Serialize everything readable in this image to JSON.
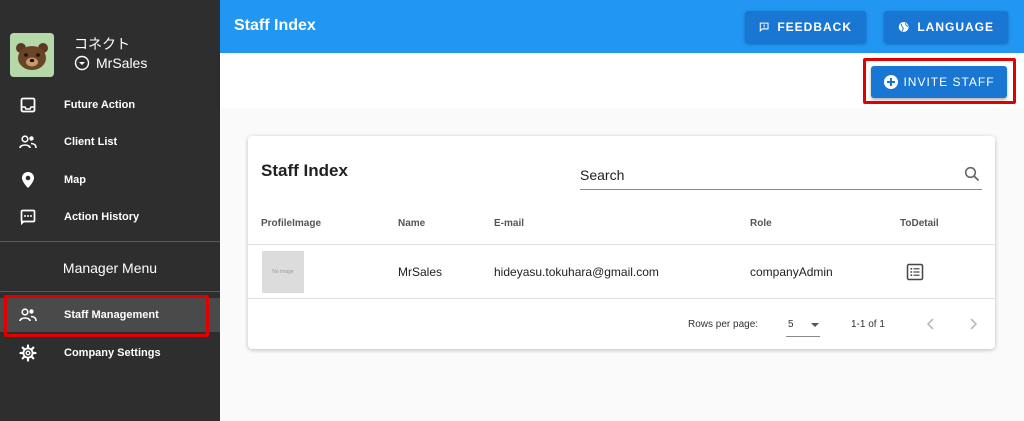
{
  "sidebar": {
    "company": "コネクト",
    "user": "MrSales",
    "items": [
      {
        "label": "Future Action",
        "icon": "inbox-icon"
      },
      {
        "label": "Client List",
        "icon": "people-icon"
      },
      {
        "label": "Map",
        "icon": "map-pin-icon"
      },
      {
        "label": "Action History",
        "icon": "message-icon"
      }
    ],
    "manager_header": "Manager Menu",
    "manager_items": [
      {
        "label": "Staff Management",
        "icon": "people-icon",
        "active": true
      },
      {
        "label": "Company Settings",
        "icon": "gear-icon"
      }
    ]
  },
  "header": {
    "title": "Staff Index",
    "feedback_label": "FEEDBACK",
    "language_label": "LANGUAGE"
  },
  "toolbar": {
    "invite_label": "INVITE STAFF"
  },
  "card": {
    "title": "Staff Index",
    "search_placeholder": "Search",
    "columns": [
      "ProfileImage",
      "Name",
      "E-mail",
      "Role",
      "ToDetail"
    ],
    "rows": [
      {
        "image_text": "No image",
        "name": "MrSales",
        "email": "hideyasu.tokuhara@gmail.com",
        "role": "companyAdmin"
      }
    ],
    "footer": {
      "rows_per_page_label": "Rows per page:",
      "rows_per_page_value": "5",
      "range": "1-1 of 1"
    }
  },
  "colors": {
    "appbar": "#2196f3",
    "button": "#1976d2",
    "sidebar": "#2e2e2e",
    "highlight": "#e00000"
  }
}
